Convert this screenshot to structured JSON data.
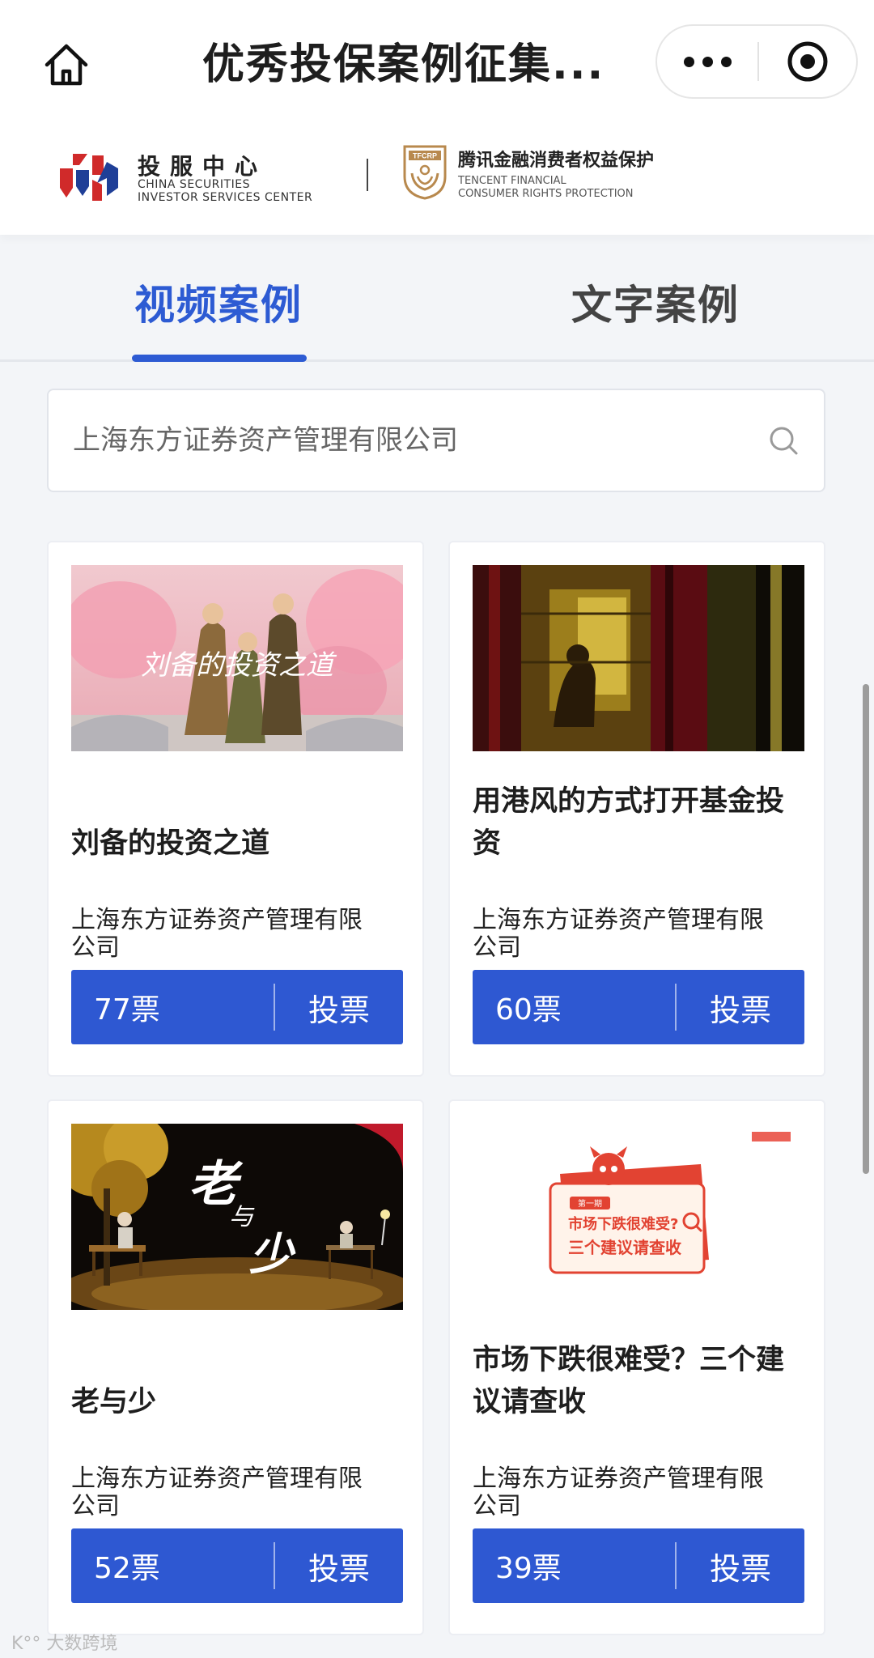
{
  "header": {
    "title": "优秀投保案例征集..."
  },
  "logos": {
    "left_cn": "投服中心",
    "left_en_1": "CHINA SECURITIES",
    "left_en_2": "INVESTOR SERVICES CENTER",
    "right_badge": "TFCRP",
    "right_cn": "腾讯金融消费者权益保护",
    "right_en_1": "TENCENT FINANCIAL",
    "right_en_2": "CONSUMER RIGHTS PROTECTION"
  },
  "tabs": [
    {
      "label": "视频案例",
      "active": true
    },
    {
      "label": "文字案例",
      "active": false
    }
  ],
  "search": {
    "value": "上海东方证券资产管理有限公司"
  },
  "cards": [
    {
      "title": "刘备的投资之道",
      "company": [
        "上海东方证券资产管理有限",
        "公司"
      ],
      "votes": "77票",
      "vote_label": "投票",
      "thumb_text": "刘备的投资之道"
    },
    {
      "title": "用港风的方式打开基金投资",
      "company": [
        "上海东方证券资产管理有限",
        "公司"
      ],
      "votes": "60票",
      "vote_label": "投票"
    },
    {
      "title": "老与少",
      "company": [
        "上海东方证券资产管理有限",
        "公司"
      ],
      "votes": "52票",
      "vote_label": "投票",
      "thumb_text": [
        "老",
        "与",
        "少"
      ]
    },
    {
      "title": "市场下跌很难受？三个建议请查收",
      "company": [
        "上海东方证券资产管理有限",
        "公司"
      ],
      "votes": "39票",
      "vote_label": "投票",
      "thumb_text": {
        "tag": "第一期",
        "line1": "市场下跌很难受?",
        "line2": "三个建议请查收"
      }
    }
  ],
  "watermark": "K°° 大数跨境",
  "colors": {
    "accent": "#2d5bd3",
    "vote_bar": "#2e58d2",
    "background": "#f3f5f8"
  },
  "icons": [
    "home-icon",
    "more-icon",
    "close-icon",
    "search-icon"
  ]
}
